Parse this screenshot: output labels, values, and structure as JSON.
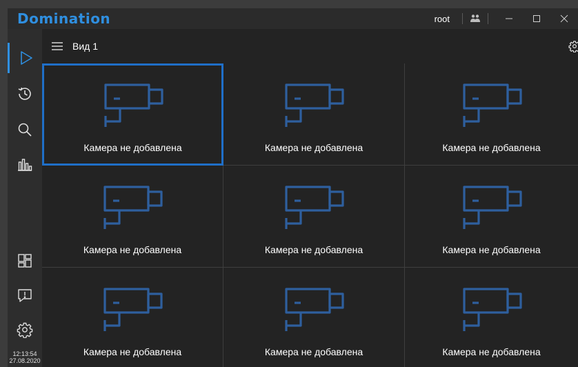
{
  "app": {
    "brand": "Domination",
    "user": "root"
  },
  "toolbar": {
    "view_title": "Вид 1"
  },
  "sidebar": {
    "items": [
      {
        "icon": "play-icon",
        "active": true
      },
      {
        "icon": "history-icon"
      },
      {
        "icon": "search-icon"
      },
      {
        "icon": "chart-icon"
      },
      {
        "icon": "layout-icon"
      },
      {
        "icon": "alert-icon"
      },
      {
        "icon": "gear-icon"
      }
    ],
    "time": "12:13:54",
    "date": "27.08.2020"
  },
  "grid": {
    "cells": [
      {
        "caption": "Камера не добавлена",
        "selected": true
      },
      {
        "caption": "Камера не добавлена"
      },
      {
        "caption": "Камера не добавлена"
      },
      {
        "caption": "Камера не добавлена"
      },
      {
        "caption": "Камера не добавлена"
      },
      {
        "caption": "Камера не добавлена"
      },
      {
        "caption": "Камера не добавлена"
      },
      {
        "caption": "Камера не добавлена"
      },
      {
        "caption": "Камера не добавлена"
      }
    ]
  },
  "colors": {
    "accent": "#2f8fe0",
    "camera_icon": "#2e5f9e",
    "selected_border": "#1f6fc8"
  }
}
